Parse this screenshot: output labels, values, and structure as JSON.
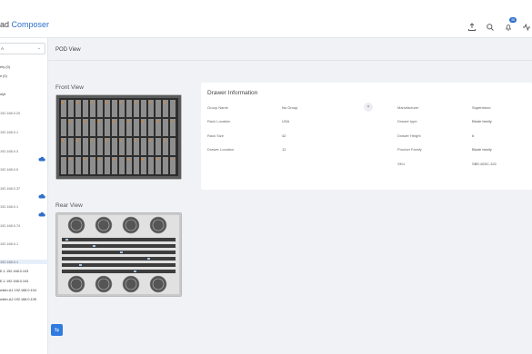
{
  "app": {
    "title_part1": "ad",
    "title_part2": "Composer",
    "notification_count": "38"
  },
  "sidebar": {
    "select_value": "A",
    "items": [
      {
        "label": "ery (0)"
      },
      {
        "label": "e (0)"
      },
      {
        "label": "olyt"
      },
      {
        "label": "192.168.0.20"
      },
      {
        "label": "192.168.0.1"
      },
      {
        "label": "192.168.0.3"
      },
      {
        "label": "192.168.0.5"
      },
      {
        "label": "192.168.0.37"
      },
      {
        "label": "192.168.0.1"
      },
      {
        "label": "192.168.0.74"
      },
      {
        "label": "192.168.0.1"
      },
      {
        "label": "192.168.0.1"
      },
      {
        "label": "E-1  192.168.0.103"
      },
      {
        "label": "E-1  192.168.0.104"
      },
      {
        "label": "witch-A1  192.168.0.104"
      },
      {
        "label": "witch-A2  192.168.0.105"
      }
    ]
  },
  "main": {
    "pod_view_title": "POD View",
    "front_view_label": "Front View",
    "rear_view_label": "Rear View"
  },
  "drawer": {
    "title": "Drawer Information",
    "left_fields": [
      {
        "label": "Group Name",
        "value": "No Group"
      },
      {
        "label": "Rack Location",
        "value": "USA"
      },
      {
        "label": "Rack Size",
        "value": "42"
      },
      {
        "label": "Drawer Location",
        "value": "12"
      }
    ],
    "right_fields": [
      {
        "label": "Manufacturer",
        "value": "Supermicro"
      },
      {
        "label": "Drawer type",
        "value": "Blade family"
      },
      {
        "label": "Drawer Height",
        "value": "6"
      },
      {
        "label": "Product Family",
        "value": "Blade family"
      },
      {
        "label": "SKU",
        "value": "SBE-820C-322"
      }
    ]
  },
  "colors": {
    "accent": "#2f6fc9",
    "button": "#2f7be0",
    "page_bg": "#f0f2f5"
  }
}
